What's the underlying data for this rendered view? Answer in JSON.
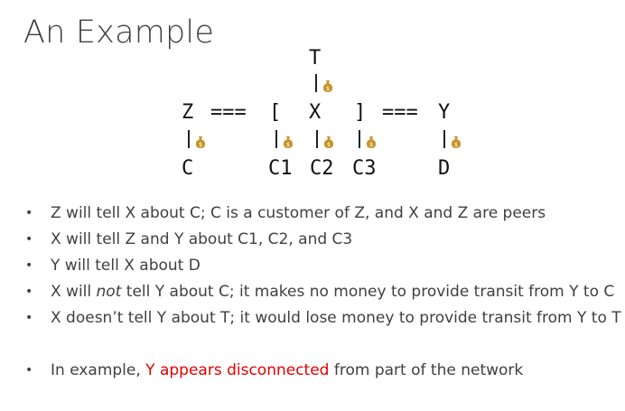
{
  "title": "An Example",
  "diagram": {
    "top_label": "T",
    "row_text": "Z === [  X  ] === Y",
    "z": "Z",
    "eq_left": "===",
    "bracket_open": "[",
    "x": "X",
    "bracket_close": "]",
    "eq_right": "===",
    "y": "Y",
    "c": "C",
    "c1": "C1",
    "c2": "C2",
    "c3": "C3",
    "d": "D",
    "money_icon": "money-bag",
    "money_color": "#c8952c"
  },
  "bullets": [
    {
      "text": "Z will tell X about C; C is a customer of Z, and X and Z are peers"
    },
    {
      "text": "X will tell Z and Y about C1, C2, and C3"
    },
    {
      "text": "Y will tell X about D"
    },
    {
      "pre": "X will ",
      "em": "not",
      "post": " tell Y about C; it makes no money to provide transit from Y to C"
    },
    {
      "text": "X doesn’t tell Y about T; it would lose money to provide transit from Y to T"
    }
  ],
  "final_bullet": {
    "pre": "In example, ",
    "highlight": "Y appears disconnected",
    "post": " from part of the network",
    "highlight_color": "#e00000"
  },
  "bullet_char": "•"
}
